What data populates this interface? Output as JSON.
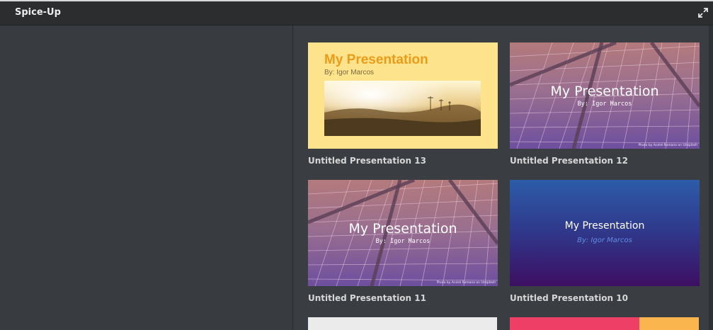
{
  "window": {
    "title": "Spice-Up"
  },
  "icons": {
    "fullscreen": "fullscreen-icon"
  },
  "presentations": [
    {
      "caption": "Untitled Presentation 13",
      "title": "My Presentation",
      "author": "By: Igor Marcos",
      "theme": "yellow-sunset"
    },
    {
      "caption": "Untitled Presentation 12",
      "title": "My Presentation",
      "author": "By: Igor Marcos",
      "theme": "purple-building",
      "credit": "Photo by André Romano on Unsplash"
    },
    {
      "caption": "Untitled Presentation 11",
      "title": "My Presentation",
      "author": "By: Igor Marcos",
      "theme": "purple-building",
      "credit": "Photo by André Romano on Unsplash"
    },
    {
      "caption": "Untitled Presentation 10",
      "title": "My Presentation",
      "author": "By: Igor Marcos",
      "theme": "blue-purple-gradient"
    }
  ],
  "colors": {
    "accent_yellow": "#eb9b17",
    "gradient_top": "#2c5ca8",
    "gradient_bottom": "#3d0f62"
  }
}
